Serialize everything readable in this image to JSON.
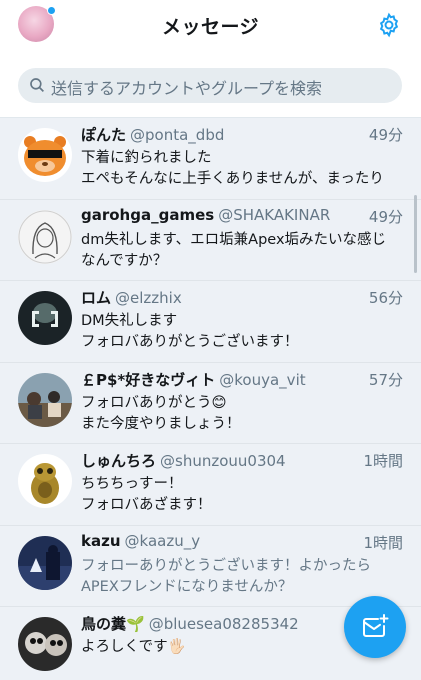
{
  "header": {
    "title": "メッセージ"
  },
  "search": {
    "placeholder": "送信するアカウントやグループを検索"
  },
  "conversations": [
    {
      "name": "ぽんた",
      "handle": "@ponta_dbd",
      "time": "49分",
      "line1": "下着に釣られました",
      "line2": "エペもそんなに上手くありませんが、まったり"
    },
    {
      "name": "garohga_games",
      "handle": "@SHAKAKINAR",
      "time": "49分",
      "line1": "dm失礼します、エロ垢兼Apex垢みたいな感じ",
      "line2": "なんですか？"
    },
    {
      "name": "ロム",
      "handle": "@elzzhix",
      "time": "56分",
      "line1": "DM失礼します",
      "line2": "フォロバありがとうございます！"
    },
    {
      "name": "￡P$*好きなヴィト",
      "handle": "@kouya_vit",
      "time": "57分",
      "line1": "フォロバありがとう😊",
      "line2": "また今度やりましょう！"
    },
    {
      "name": "しゅんちろ",
      "handle": "@shunzouu0304",
      "time": "1時間",
      "line1": "ちちちっすー！",
      "line2": "フォロバあざます！"
    },
    {
      "name": "kazu",
      "handle": "@kaazu_y",
      "time": "1時間",
      "line1": "フォローありがとうございます！よかったら",
      "line2": "APEXフレンドになりませんか？"
    },
    {
      "name": "鳥の糞🌱",
      "handle": "@bluesea08285342",
      "time": "",
      "line1": "よろしくです🖐🏻",
      "line2": ""
    }
  ],
  "icons": {
    "settings": "gear-icon",
    "search": "search-icon",
    "compose": "new-message-icon"
  },
  "colors": {
    "accent": "#1da1f2",
    "row_background": "#edf1f6",
    "secondary_text": "#657786"
  }
}
